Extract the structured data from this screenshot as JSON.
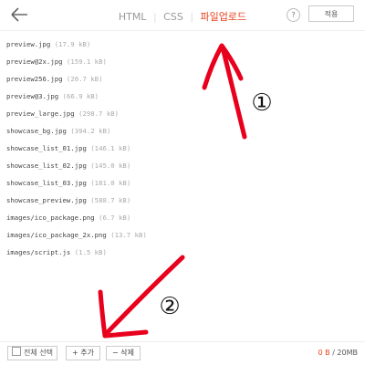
{
  "header": {
    "tabs": [
      {
        "label": "HTML",
        "active": false
      },
      {
        "label": "CSS",
        "active": false
      },
      {
        "label": "파일업로드",
        "active": true
      }
    ],
    "help_label": "?",
    "apply_label": "적용"
  },
  "files": [
    {
      "name": "preview.jpg",
      "size": "(17.9 kB)"
    },
    {
      "name": "preview@2x.jpg",
      "size": "(159.1 kB)"
    },
    {
      "name": "preview256.jpg",
      "size": "(20.7 kB)"
    },
    {
      "name": "preview@3.jpg",
      "size": "(66.9 kB)"
    },
    {
      "name": "preview_large.jpg",
      "size": "(298.7 kB)"
    },
    {
      "name": "showcase_bg.jpg",
      "size": "(394.2 kB)"
    },
    {
      "name": "showcase_list_01.jpg",
      "size": "(146.1 kB)"
    },
    {
      "name": "showcase_list_02.jpg",
      "size": "(145.0 kB)"
    },
    {
      "name": "showcase_list_03.jpg",
      "size": "(181.0 kB)"
    },
    {
      "name": "showcase_preview.jpg",
      "size": "(588.7 kB)"
    },
    {
      "name": "images/ico_package.png",
      "size": "(6.7 kB)"
    },
    {
      "name": "images/ico_package_2x.png",
      "size": "(13.7 kB)"
    },
    {
      "name": "images/script.js",
      "size": "(1.5 kB)"
    }
  ],
  "footer": {
    "select_all_label": "전체 선택",
    "add_label": "+ 추가",
    "delete_label": "− 삭제",
    "used": "0 B",
    "total": "/ 20MB"
  },
  "annotations": {
    "marker1": "①",
    "marker2": "②",
    "color": "#e8001c"
  },
  "colors": {
    "accent": "#e8431f"
  }
}
